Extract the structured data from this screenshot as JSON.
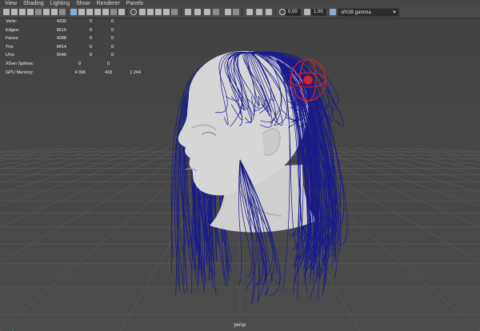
{
  "menu": [
    "View",
    "Shading",
    "Lighting",
    "Show",
    "Renderer",
    "Panels"
  ],
  "toolbar": {
    "exposure_value": "0.00",
    "gamma_value": "1.00",
    "color_space": "sRGB gamma"
  },
  "hud": {
    "rows": [
      {
        "label": "Verts:",
        "values": [
          "4330",
          "0",
          "0"
        ]
      },
      {
        "label": "Edges:",
        "values": [
          "8615",
          "0",
          "0"
        ]
      },
      {
        "label": "Faces:",
        "values": [
          "4288",
          "0",
          "0"
        ]
      },
      {
        "label": "Tris:",
        "values": [
          "8414",
          "0",
          "0"
        ]
      },
      {
        "label": "UVs:",
        "values": [
          "5048",
          "0",
          "0"
        ]
      }
    ],
    "xgen": {
      "label": "XGen Splines:",
      "values": [
        "0",
        "0"
      ]
    },
    "gpu": {
      "label": "GPU Memory:",
      "values": [
        "4 096",
        "418",
        "1 244"
      ]
    }
  },
  "viewport": {
    "camera": "persp",
    "grid_color": "#5a5a5a",
    "hair_color": "#1a1a8c",
    "head_color": "#d6d6d6",
    "manipulator_color": "#e02020"
  }
}
